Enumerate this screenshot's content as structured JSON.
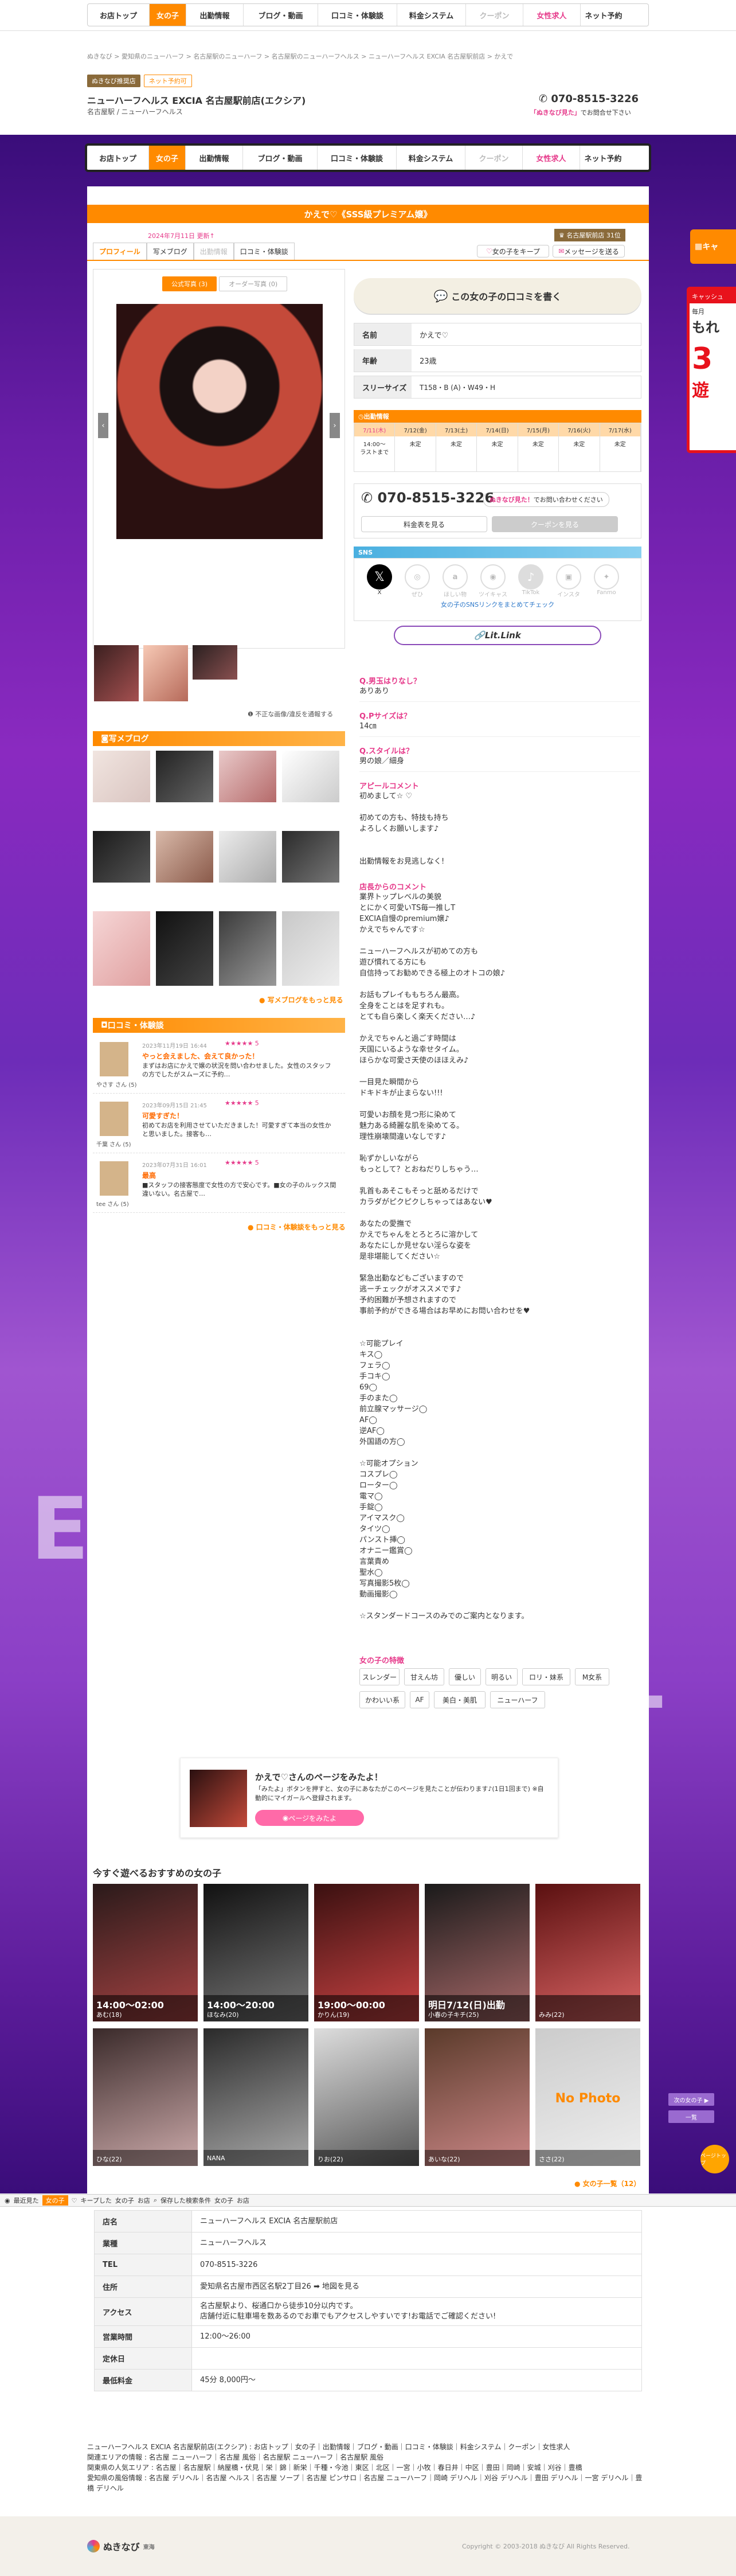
{
  "nav": {
    "items": [
      "お店トップ",
      "女の子",
      "出勤情報",
      "ブログ・動画",
      "口コミ・体験談",
      "料金システム",
      "クーポン",
      "女性求人",
      "ネット予約"
    ]
  },
  "shop": {
    "badge_tenpo": "ぬきなび推奨店",
    "badge_net": "ネット予約可",
    "name": "ニューハーフヘルス EXCIA 名古屋駅前店(エクシア)",
    "sub": "名古屋駅 / ニューハーフヘルス",
    "tel": "070-8515-3226",
    "tel_note_red": "「ぬきなび見た」",
    "tel_note": "でお問合せ下さい"
  },
  "breadcrumb": "ぬきなび > 愛知県のニューハーフ > 名古屋駅のニューハーフ > 名古屋駅のニューハーフヘルス > ニューハーフヘルス EXCIA 名古屋駅前店 > かえで",
  "profile": {
    "title": "かえで♡《SSS級プレミアム嬢》",
    "date": "2024年7月11日 更新↑",
    "rank_badge": "名古屋駅前店 31位",
    "fav_btn": "女の子をキープ",
    "msg_btn": "メッセージを送る",
    "tabs": [
      "プロフィール",
      "写メブログ",
      "出勤情報",
      "口コミ・体験談"
    ],
    "photo_tabs": [
      "公式写真 (3)",
      "オーダー写真 (0)"
    ],
    "photo_note": "不正な画像/違反を通報する",
    "review_btn": "この女の子の口コミを書く",
    "fields": [
      {
        "k": "名前",
        "v": "かえで♡"
      },
      {
        "k": "年齢",
        "v": "23歳"
      },
      {
        "k": "スリーサイズ",
        "v": "T158・B (A)・W49・H"
      }
    ],
    "schedule_head": "出勤情報",
    "schedule_days": [
      "7/11(木)",
      "7/12(金)",
      "7/13(土)",
      "7/14(日)",
      "7/15(月)",
      "7/16(火)",
      "7/17(水)"
    ],
    "schedule_vals": [
      "14:00〜\nラストまで",
      "未定",
      "未定",
      "未定",
      "未定",
      "未定",
      "未定"
    ],
    "tel": "070-8515-3226",
    "tel_red": "ぬきなび見た！",
    "tel_note": "でお問い合わせください",
    "price_btn": "料金表を見る",
    "coupon_btn": "クーポンを見る",
    "sns_head": "SNS",
    "sns": [
      "X",
      "ぜひ",
      "ほしい物",
      "ツイキャス",
      "TikTok",
      "インスタ",
      "Fanmo"
    ],
    "sns_note": "女の子のSNSリンクをまとめてチェック",
    "lit_link": "Lit.Link"
  },
  "blog": {
    "head": "写メブログ",
    "more": "写メブログをもっと見る"
  },
  "reviews": {
    "head": "口コミ・体験談",
    "items": [
      {
        "date": "2023年11月19日 16:44",
        "stars": "★★★★★ 5",
        "title": "やっと会えました、会えて良かった！",
        "body": "まずはお店にかえで嬢の状況を問い合わせました。女性のスタッフの方でしたがスムーズに予約…",
        "user": "やさす"
      },
      {
        "date": "2023年09月15日 21:45",
        "stars": "★★★★★ 5",
        "title": "可愛すぎた！",
        "body": "初めてお店を利用させていただきました！可愛すぎて本当の女性かと思いました。接客も…",
        "user": "千葉"
      },
      {
        "date": "2023年07月31日 16:01",
        "stars": "★★★★★ 5",
        "title": "最高",
        "body": "■スタッフの接客態度で女性の方で安心です。■女の子のルックス間違いない。名古屋で…",
        "user": "tee"
      }
    ],
    "more": "口コミ・体験談をもっと見る"
  },
  "qa": [
    {
      "q": "Q.男玉はりなし？",
      "a": "ありあり"
    },
    {
      "q": "Q.Pサイズは？",
      "a": "14㎝"
    },
    {
      "q": "Q.スタイルは？",
      "a": "男の娘／細身"
    }
  ],
  "appeal": {
    "head": "アピールコメント",
    "lines": [
      "初めまして☆ ♡",
      "",
      "初めての方も、特技も持ち",
      "よろしくお願いします♪",
      "",
      "",
      "出勤情報をお見逃しなく!"
    ]
  },
  "shop_comment": {
    "head": "店長からのコメント",
    "lines": [
      "業界トップレベルの美貌",
      "とにかく可愛いTS毎一推しT",
      "EXCIA自慢のpremium嬢♪",
      "かえでちゃんです☆",
      "",
      "ニューハーフヘルスが初めての方も",
      "遊び慣れてる方にも",
      "自信持ってお勧めできる極上のオトコの娘♪",
      "",
      "お話もプレイももちろん最高。",
      "全身をことはを足すれも。",
      "とても自ら楽しく楽天ください…♪",
      "",
      "かえでちゃんと過ごす時間は",
      "天国にいるような幸せタイム。",
      "ほらかな可愛さ天使のほほえみ♪",
      "",
      "一目見た瞬間から",
      "ドキドキが止まらない!!!",
      "",
      "可愛いお顔を見つ形に染めて",
      "魅力ある綺麗な肌を染めてる。",
      "理性崩壊間違いなしです♪",
      "",
      "恥ずかしいながら",
      "もっとして？とおねだりしちゃう…",
      "",
      "乳首もあそこもそっと舐めるだけで",
      "カラダがピクピクしちゃってはあない♥",
      "",
      "あなたの愛撫で",
      "かえでちゃんをとろとろに溶かして",
      "あなたにしか見せない淫らな姿を",
      "是非堪能してください☆",
      "",
      "緊急出勤などもございますので",
      "逃ーチェックがオススメです♪",
      "予約困難が予想されますので",
      "事前予約ができる場合はお早めにお問い合わせを♥",
      "",
      "",
      "☆可能プレイ",
      "キス◯",
      "フェラ◯",
      "手コキ◯",
      "69◯",
      "手のまた◯",
      "前立腺マッサージ◯",
      "AF◯",
      "逆AF◯",
      "外国語の方◯",
      "",
      "☆可能オプション",
      "コスプレ◯",
      "ローター◯",
      "電マ◯",
      "手錠◯",
      "アイマスク◯",
      "タイツ◯",
      "パンスト挿◯",
      "オナニー鑑賞◯",
      "言葉責め",
      "聖水◯",
      "写真撮影5枚◯",
      "動画撮影◯",
      "",
      "☆スタンダードコースのみでのご案内となります。"
    ]
  },
  "traits": {
    "head": "女の子の特徴",
    "tags": [
      "スレンダー",
      "甘えん坊",
      "優しい",
      "明るい",
      "ロリ・妹系",
      "M女系",
      "かわいい系",
      "AF",
      "美白・美肌",
      "ニューハーフ"
    ]
  },
  "promo": {
    "title": "かえで♡さんのページをみたよ！",
    "body": "「みたよ」ボタンを押すと、女の子にあなたがこのページを見たことが伝わります♪(1日1回まで) ※自動的にマイガールへ登録されます。",
    "btn": "ページをみたよ"
  },
  "recommend": {
    "head": "今すぐ遊べるおすすめの女の子",
    "row1": [
      {
        "time": "14:00〜02:00",
        "name": "あむ(18)"
      },
      {
        "time": "14:00〜20:00",
        "name": "ほなみ(20)"
      },
      {
        "time": "19:00〜00:00",
        "name": "かりん(19)"
      },
      {
        "time": "明日7/12(日)出勤",
        "name": "小春の子キチ(25)"
      },
      {
        "time": "",
        "name": "みみ(22)"
      }
    ],
    "row2": [
      {
        "time": "",
        "name": "ひな(22)"
      },
      {
        "time": "",
        "name": "NANA"
      },
      {
        "time": "",
        "name": "りお(22)"
      },
      {
        "time": "",
        "name": "あいな(22)"
      },
      {
        "time": "",
        "name": "ささ(22)"
      }
    ],
    "nophoto": "No Photo",
    "more": "女の子一覧（12）"
  },
  "bottom_bar": {
    "items": [
      "最近見た",
      "女の子",
      "キープした",
      "女の子",
      "お店",
      "保存した検索条件",
      "女の子",
      "お店"
    ]
  },
  "info": [
    {
      "k": "店名",
      "v": "ニューハーフヘルス EXCIA 名古屋駅前店"
    },
    {
      "k": "業種",
      "v": "ニューハーフヘルス"
    },
    {
      "k": "TEL",
      "v": "070-8515-3226"
    },
    {
      "k": "住所",
      "v": "愛知県名古屋市西区名駅2丁目26 ➡ 地図を見る"
    },
    {
      "k": "アクセス",
      "v": "名古屋駅より、桜通口から徒歩10分以内です。\n店舗付近に駐車場を数あるのでお車でもアクセスしやすいです!お電話でご確認ください!"
    },
    {
      "k": "営業時間",
      "v": "12:00〜26:00"
    },
    {
      "k": "定休日",
      "v": ""
    },
    {
      "k": "最低料金",
      "v": "45分 8,000円〜"
    }
  ],
  "footer": {
    "line1": "ニューハーフヘルス EXCIA 名古屋駅前店(エクシア) : お店トップ｜女の子｜出勤情報｜ブログ・動画｜口コミ・体験談｜料金システム｜クーポン｜女性求人",
    "line2": "関連エリアの情報 : 名古屋 ニューハーフ｜名古屋 風俗｜名古屋駅 ニューハーフ｜名古屋駅 風俗",
    "line3": "関東県の人気エリア : 名古屋｜名古屋駅｜納屋橋・伏見｜栄｜錦｜新栄｜千種・今池｜東区｜北区｜一宮｜小牧｜春日井｜中区｜豊田｜岡崎｜安城｜刈谷｜豊橋",
    "line4": "愛知県の風俗情報 : 名古屋 デリヘル｜名古屋 ヘルス｜名古屋 ソープ｜名古屋 ピンサロ｜名古屋 ニューハーフ｜岡崎 デリヘル｜刈谷 デリヘル｜豊田 デリヘル｜一宮 デリヘル｜豊橋 デリヘル",
    "logo": "ぬきなび",
    "logo_sub": "東海",
    "copyright": "Copyright © 2003-2018 ぬきなび All Rights Reserved."
  },
  "side": {
    "right_tab": "キャ",
    "right_ad1": "キャッシュ",
    "right_ad2": "毎月",
    "right_ad3": "もれ",
    "right_ad4": "3",
    "right_ad5": "遊",
    "float1": "次の女の子 ▶",
    "float2": "一覧",
    "float3": "ページトップ"
  },
  "colors": {
    "accent": "#ff8a00",
    "pink": "#e6398a",
    "purple": "#6a1ea8"
  }
}
